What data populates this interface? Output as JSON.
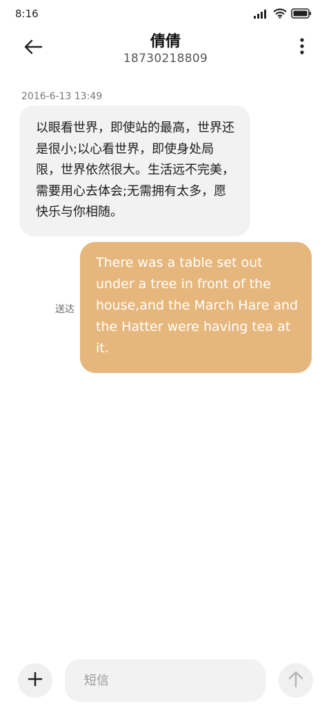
{
  "status_bar": {
    "time": "8:16",
    "icons": [
      "signal-icon",
      "wifi-icon",
      "battery-icon"
    ]
  },
  "header": {
    "back_icon": "arrow-left-icon",
    "contact_name": "倩倩",
    "contact_number": "18730218809",
    "more_icon": "more-vertical-icon"
  },
  "conversation": {
    "timestamp": "2016-6-13 13:49",
    "incoming_message": "以眼看世界，即使站的最高，世界还是很小;以心看世界，即使身处局限，世界依然很大。生活远不完美，需要用心去体会;无需拥有太多，愿快乐与你相随。",
    "outgoing_message": "There was a table set out under a tree in front of the house,and the March Hare and the Hatter were having tea at it.",
    "outgoing_status": "送达"
  },
  "composer": {
    "add_icon": "plus-icon",
    "input_placeholder": "短信",
    "input_value": "",
    "send_icon": "arrow-up-icon"
  },
  "colors": {
    "incoming_bubble": "#f2f2f2",
    "outgoing_bubble": "#e6b77c",
    "outgoing_text": "#ffffff"
  }
}
